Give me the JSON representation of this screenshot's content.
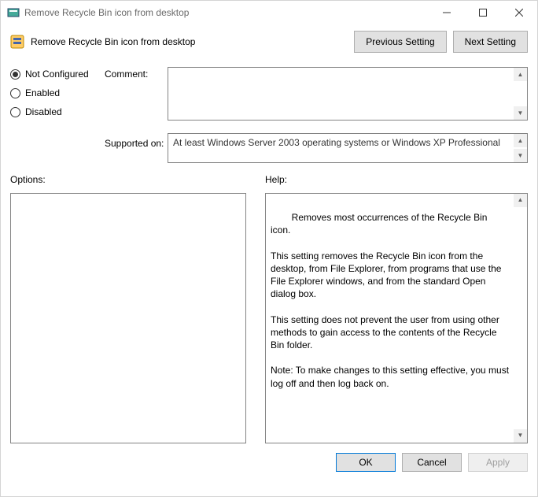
{
  "window": {
    "title": "Remove Recycle Bin icon from desktop"
  },
  "header": {
    "setting_title": "Remove Recycle Bin icon from desktop",
    "prev_btn": "Previous Setting",
    "next_btn": "Next Setting"
  },
  "state": {
    "options": [
      "Not Configured",
      "Enabled",
      "Disabled"
    ],
    "selected_index": 0
  },
  "labels": {
    "comment": "Comment:",
    "supported": "Supported on:",
    "options": "Options:",
    "help": "Help:"
  },
  "supported_text": "At least Windows Server 2003 operating systems or Windows XP Professional",
  "help_text": "Removes most occurrences of the Recycle Bin icon.\n\nThis setting removes the Recycle Bin icon from the desktop, from File Explorer, from programs that use the File Explorer windows, and from the standard Open dialog box.\n\nThis setting does not prevent the user from using other methods to gain access to the contents of the Recycle Bin folder.\n\nNote: To make changes to this setting effective, you must log off and then log back on.",
  "footer": {
    "ok": "OK",
    "cancel": "Cancel",
    "apply": "Apply"
  }
}
